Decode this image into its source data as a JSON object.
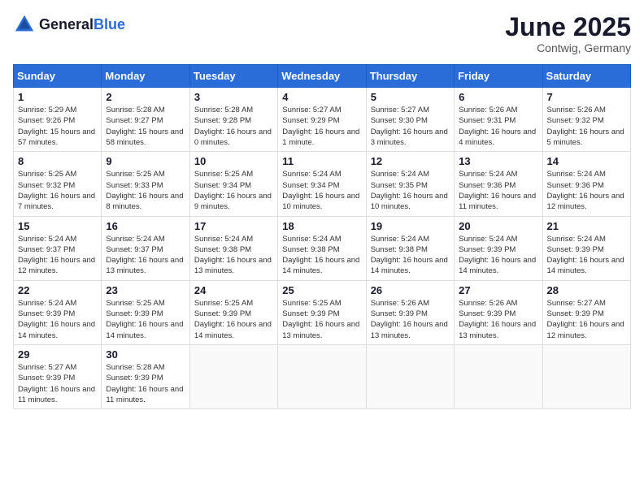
{
  "logo": {
    "general": "General",
    "blue": "Blue"
  },
  "header": {
    "month": "June 2025",
    "location": "Contwig, Germany"
  },
  "days_of_week": [
    "Sunday",
    "Monday",
    "Tuesday",
    "Wednesday",
    "Thursday",
    "Friday",
    "Saturday"
  ],
  "weeks": [
    [
      {
        "day": "1",
        "sunrise": "5:29 AM",
        "sunset": "9:26 PM",
        "daylight": "15 hours and 57 minutes."
      },
      {
        "day": "2",
        "sunrise": "5:28 AM",
        "sunset": "9:27 PM",
        "daylight": "15 hours and 58 minutes."
      },
      {
        "day": "3",
        "sunrise": "5:28 AM",
        "sunset": "9:28 PM",
        "daylight": "16 hours and 0 minutes."
      },
      {
        "day": "4",
        "sunrise": "5:27 AM",
        "sunset": "9:29 PM",
        "daylight": "16 hours and 1 minute."
      },
      {
        "day": "5",
        "sunrise": "5:27 AM",
        "sunset": "9:30 PM",
        "daylight": "16 hours and 3 minutes."
      },
      {
        "day": "6",
        "sunrise": "5:26 AM",
        "sunset": "9:31 PM",
        "daylight": "16 hours and 4 minutes."
      },
      {
        "day": "7",
        "sunrise": "5:26 AM",
        "sunset": "9:32 PM",
        "daylight": "16 hours and 5 minutes."
      }
    ],
    [
      {
        "day": "8",
        "sunrise": "5:25 AM",
        "sunset": "9:32 PM",
        "daylight": "16 hours and 7 minutes."
      },
      {
        "day": "9",
        "sunrise": "5:25 AM",
        "sunset": "9:33 PM",
        "daylight": "16 hours and 8 minutes."
      },
      {
        "day": "10",
        "sunrise": "5:25 AM",
        "sunset": "9:34 PM",
        "daylight": "16 hours and 9 minutes."
      },
      {
        "day": "11",
        "sunrise": "5:24 AM",
        "sunset": "9:34 PM",
        "daylight": "16 hours and 10 minutes."
      },
      {
        "day": "12",
        "sunrise": "5:24 AM",
        "sunset": "9:35 PM",
        "daylight": "16 hours and 10 minutes."
      },
      {
        "day": "13",
        "sunrise": "5:24 AM",
        "sunset": "9:36 PM",
        "daylight": "16 hours and 11 minutes."
      },
      {
        "day": "14",
        "sunrise": "5:24 AM",
        "sunset": "9:36 PM",
        "daylight": "16 hours and 12 minutes."
      }
    ],
    [
      {
        "day": "15",
        "sunrise": "5:24 AM",
        "sunset": "9:37 PM",
        "daylight": "16 hours and 12 minutes."
      },
      {
        "day": "16",
        "sunrise": "5:24 AM",
        "sunset": "9:37 PM",
        "daylight": "16 hours and 13 minutes."
      },
      {
        "day": "17",
        "sunrise": "5:24 AM",
        "sunset": "9:38 PM",
        "daylight": "16 hours and 13 minutes."
      },
      {
        "day": "18",
        "sunrise": "5:24 AM",
        "sunset": "9:38 PM",
        "daylight": "16 hours and 14 minutes."
      },
      {
        "day": "19",
        "sunrise": "5:24 AM",
        "sunset": "9:38 PM",
        "daylight": "16 hours and 14 minutes."
      },
      {
        "day": "20",
        "sunrise": "5:24 AM",
        "sunset": "9:39 PM",
        "daylight": "16 hours and 14 minutes."
      },
      {
        "day": "21",
        "sunrise": "5:24 AM",
        "sunset": "9:39 PM",
        "daylight": "16 hours and 14 minutes."
      }
    ],
    [
      {
        "day": "22",
        "sunrise": "5:24 AM",
        "sunset": "9:39 PM",
        "daylight": "16 hours and 14 minutes."
      },
      {
        "day": "23",
        "sunrise": "5:25 AM",
        "sunset": "9:39 PM",
        "daylight": "16 hours and 14 minutes."
      },
      {
        "day": "24",
        "sunrise": "5:25 AM",
        "sunset": "9:39 PM",
        "daylight": "16 hours and 14 minutes."
      },
      {
        "day": "25",
        "sunrise": "5:25 AM",
        "sunset": "9:39 PM",
        "daylight": "16 hours and 13 minutes."
      },
      {
        "day": "26",
        "sunrise": "5:26 AM",
        "sunset": "9:39 PM",
        "daylight": "16 hours and 13 minutes."
      },
      {
        "day": "27",
        "sunrise": "5:26 AM",
        "sunset": "9:39 PM",
        "daylight": "16 hours and 13 minutes."
      },
      {
        "day": "28",
        "sunrise": "5:27 AM",
        "sunset": "9:39 PM",
        "daylight": "16 hours and 12 minutes."
      }
    ],
    [
      {
        "day": "29",
        "sunrise": "5:27 AM",
        "sunset": "9:39 PM",
        "daylight": "16 hours and 11 minutes."
      },
      {
        "day": "30",
        "sunrise": "5:28 AM",
        "sunset": "9:39 PM",
        "daylight": "16 hours and 11 minutes."
      },
      null,
      null,
      null,
      null,
      null
    ]
  ]
}
